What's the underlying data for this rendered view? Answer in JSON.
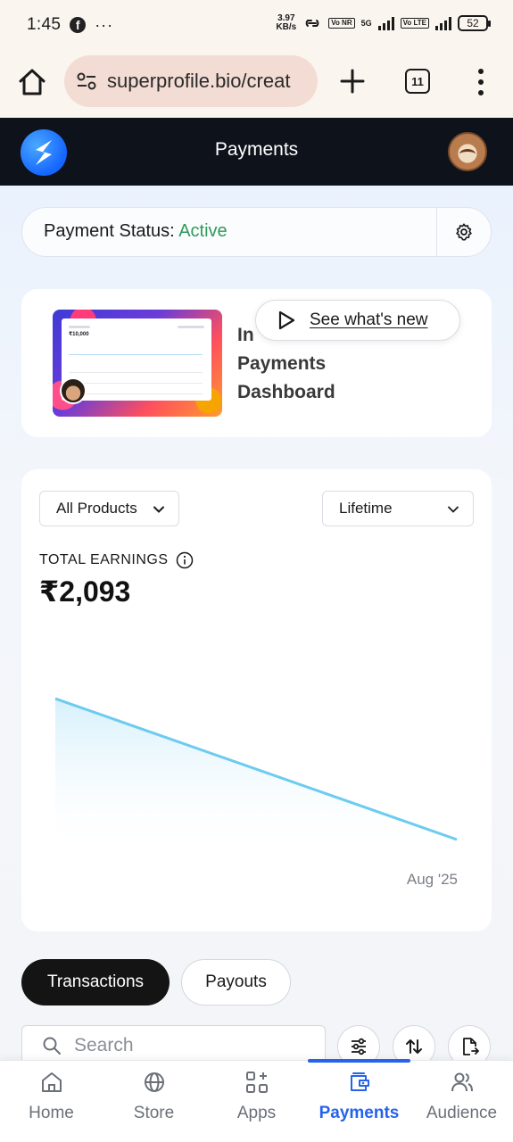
{
  "status_bar": {
    "time": "1:45",
    "network_speed_value": "3.97",
    "network_speed_unit": "KB/s",
    "network_type": "5G",
    "volte_1": "Vo NR",
    "volte_2": "Vo LTE",
    "battery": "52"
  },
  "browser": {
    "url": "superprofile.bio/creat",
    "tab_count": "11"
  },
  "header": {
    "title": "Payments"
  },
  "payment_status": {
    "label": "Payment Status:",
    "value": "Active",
    "value_color": "#2f9a5a"
  },
  "promo": {
    "title_line1": "In",
    "title_line2": "Payments",
    "title_line3": "Dashboard",
    "button_label": "See what's new",
    "thumb_amount": "₹10,000"
  },
  "earnings": {
    "product_filter": "All Products",
    "period_filter": "Lifetime",
    "label": "TOTAL EARNINGS",
    "value": "₹2,093"
  },
  "chart_data": {
    "type": "area",
    "x": [
      "",
      "Aug '25"
    ],
    "values": [
      100,
      0
    ],
    "x_tick_labels": [
      "Aug '25"
    ],
    "line_color": "#6ccbf0",
    "fill_color": "#e3f5fd",
    "grid": false,
    "legend": false,
    "title": "",
    "xlabel": "",
    "ylabel": ""
  },
  "tabs": {
    "transactions": "Transactions",
    "payouts": "Payouts"
  },
  "search": {
    "placeholder": "Search"
  },
  "bottom_nav": {
    "items": [
      {
        "label": "Home",
        "icon": "home-icon"
      },
      {
        "label": "Store",
        "icon": "globe-icon"
      },
      {
        "label": "Apps",
        "icon": "apps-icon"
      },
      {
        "label": "Payments",
        "icon": "wallet-icon"
      },
      {
        "label": "Audience",
        "icon": "users-icon"
      }
    ],
    "active": "Payments",
    "accent_color": "#2563eb"
  }
}
